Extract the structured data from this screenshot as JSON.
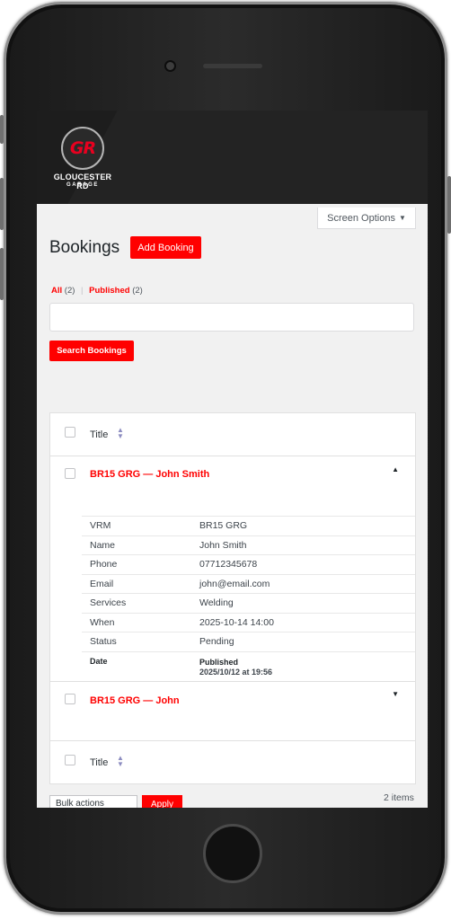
{
  "brand": {
    "logo_mark": "GR",
    "name_line1": "GLOUCESTER RD",
    "name_line2": "GARAGE"
  },
  "screen_options": {
    "label": "Screen Options",
    "icon": "caret-down-icon"
  },
  "page": {
    "title": "Bookings",
    "add_button": "Add Booking"
  },
  "filters": {
    "all_label": "All",
    "all_count": "(2)",
    "separator": "|",
    "published_label": "Published",
    "published_count": "(2)"
  },
  "search": {
    "value": "",
    "button_label": "Search Bookings"
  },
  "table": {
    "column_title": "Title",
    "rows": [
      {
        "title": "BR15 GRG — John Smith",
        "toggle": "▲",
        "details": [
          {
            "label": "VRM",
            "value": "BR15 GRG"
          },
          {
            "label": "Name",
            "value": "John Smith"
          },
          {
            "label": "Phone",
            "value": "07712345678"
          },
          {
            "label": "Email",
            "value": "john@email.com"
          },
          {
            "label": "Services",
            "value": "Welding"
          },
          {
            "label": "When",
            "value": "2025-10-14 14:00"
          },
          {
            "label": "Status",
            "value": "Pending"
          }
        ],
        "date_label": "Date",
        "date_status": "Published",
        "date_value": "2025/10/12 at 19:56"
      },
      {
        "title": "BR15 GRG — John",
        "toggle": "▼"
      }
    ]
  },
  "footer": {
    "bulk_actions": "Bulk actions",
    "apply": "Apply",
    "count": "2 items"
  },
  "colors": {
    "accent": "#ff0000",
    "header_bg": "#1d1d1d",
    "page_bg": "#f1f1f1"
  }
}
